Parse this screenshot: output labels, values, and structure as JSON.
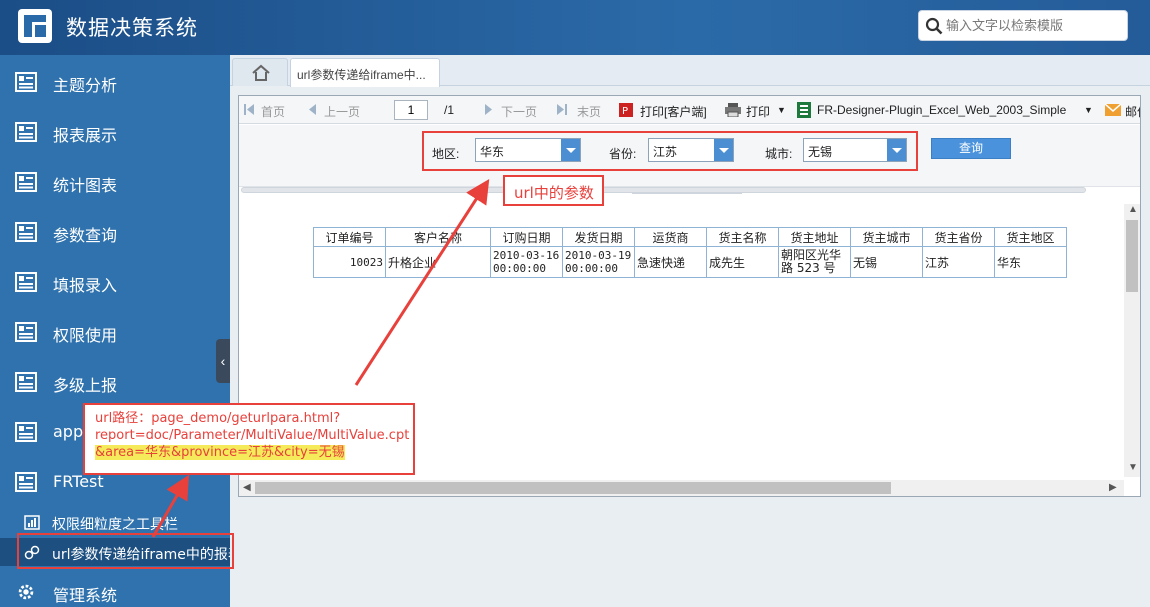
{
  "header": {
    "title": "数据决策系统",
    "search_placeholder": "输入文字以检索模版"
  },
  "sidebar": {
    "items": [
      {
        "label": "主题分析",
        "icon": "report-icon"
      },
      {
        "label": "报表展示",
        "icon": "report-icon"
      },
      {
        "label": "统计图表",
        "icon": "report-icon"
      },
      {
        "label": "参数查询",
        "icon": "report-icon"
      },
      {
        "label": "填报录入",
        "icon": "report-icon"
      },
      {
        "label": "权限使用",
        "icon": "report-icon"
      },
      {
        "label": "多级上报",
        "icon": "report-icon"
      },
      {
        "label": "app",
        "icon": "report-icon"
      },
      {
        "label": "FRTest",
        "icon": "report-icon"
      }
    ],
    "sub_items": [
      {
        "label": "权限细粒度之工具栏",
        "icon": "chart-icon"
      },
      {
        "label": "url参数传递给iframe中的报表",
        "icon": "link-icon"
      }
    ],
    "footer_item": {
      "label": "管理系统",
      "icon": "gear-icon"
    },
    "collapse_glyph": "‹"
  },
  "tabs": {
    "active_label": "url参数传递给iframe中..."
  },
  "toolbar": {
    "first": "首页",
    "prev": "上一页",
    "page_value": "1",
    "page_total": "/1",
    "next": "下一页",
    "last": "末页",
    "print_client": "打印[客户端]",
    "print": "打印",
    "export_name": "FR-Designer-Plugin_Excel_Web_2003_Simple",
    "mail": "邮件"
  },
  "params": {
    "area_label": "地区:",
    "area_value": "华东",
    "province_label": "省份:",
    "province_value": "江苏",
    "city_label": "城市:",
    "city_value": "无锡",
    "query_button": "查询"
  },
  "table": {
    "headers": [
      "订单编号",
      "客户名称",
      "订购日期",
      "发货日期",
      "运货商",
      "货主名称",
      "货主地址",
      "货主城市",
      "货主省份",
      "货主地区"
    ],
    "row": {
      "order_id": "10023",
      "customer": "升格企业",
      "order_date_1": "2010-03-16",
      "order_date_2": "00:00:00",
      "ship_date_1": "2010-03-19",
      "ship_date_2": "00:00:00",
      "shipper": "急速快递",
      "owner": "成先生",
      "address_1": "朝阳区光华",
      "address_2": "路 523 号",
      "city": "无锡",
      "province": "江苏",
      "region": "华东"
    }
  },
  "annotations": {
    "param_callout": "url中的参数",
    "url_line1": "url路径：page_demo/geturlpara.html?",
    "url_line2": "report=doc/Parameter/MultiValue/MultiValue.cpt",
    "url_line3": "&area=华东&province=江苏&city=无锡"
  },
  "colors": {
    "header_bg": "#1b4d86",
    "sidebar_bg": "#2f72ad",
    "annotation_red": "#e8413c",
    "highlight_yellow": "#f5ea5a",
    "query_button": "#4a93dc"
  }
}
